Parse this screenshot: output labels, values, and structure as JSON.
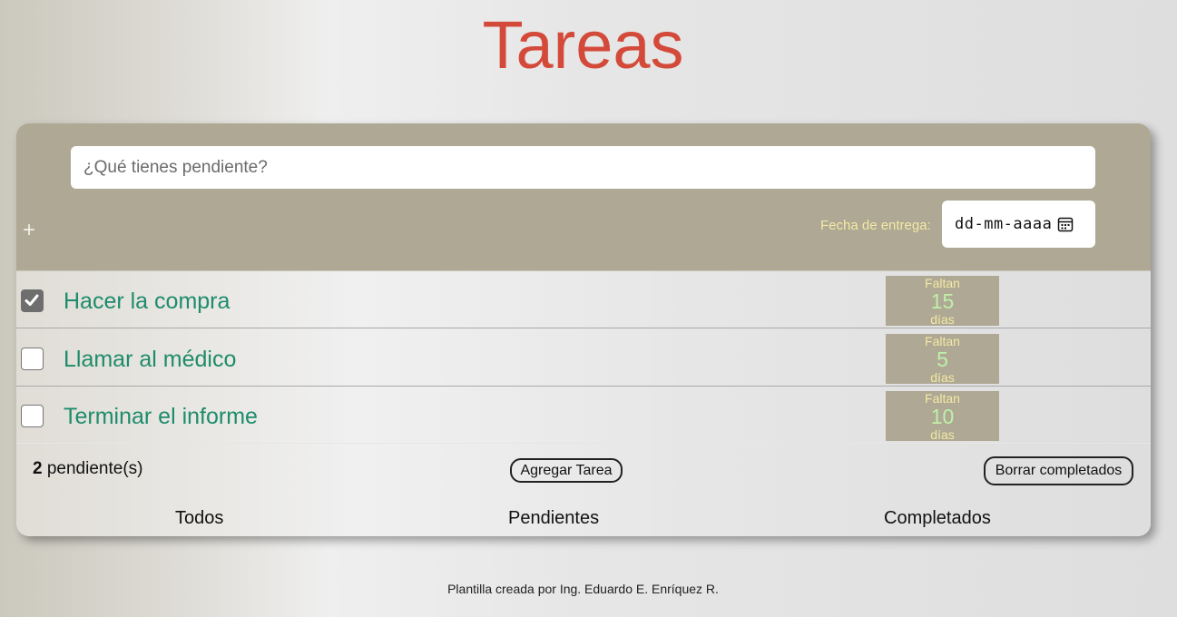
{
  "app": {
    "title": "Tareas"
  },
  "new_task": {
    "placeholder": "¿Qué tienes pendiente?",
    "add_symbol": "+",
    "date_label": "Fecha de entrega:",
    "date_value": "dd-mm-aaaa",
    "date_icon": "calendar-icon"
  },
  "tasks": [
    {
      "text": "Hacer la compra",
      "completed": true,
      "days_prefix": "Faltan",
      "days": "15",
      "days_suffix": "días"
    },
    {
      "text": "Llamar al médico",
      "completed": false,
      "days_prefix": "Faltan",
      "days": "5",
      "days_suffix": "días"
    },
    {
      "text": "Terminar el informe",
      "completed": false,
      "days_prefix": "Faltan",
      "days": "10",
      "days_suffix": "días"
    }
  ],
  "footer": {
    "pending_count": "2",
    "pending_label": "pendiente(s)",
    "add_button": "Agregar Tarea",
    "clear_button": "Borrar completados"
  },
  "filters": [
    {
      "label": "Todos"
    },
    {
      "label": "Pendientes"
    },
    {
      "label": "Completados"
    }
  ],
  "credit": "Plantilla creada por Ing. Eduardo E. Enríquez R.",
  "colors": {
    "title": "#d44a3a",
    "header_bg": "#aea895",
    "task_text": "#1e8c6c",
    "date_label": "#f4e9a3",
    "days_number": "#bff0a8"
  }
}
